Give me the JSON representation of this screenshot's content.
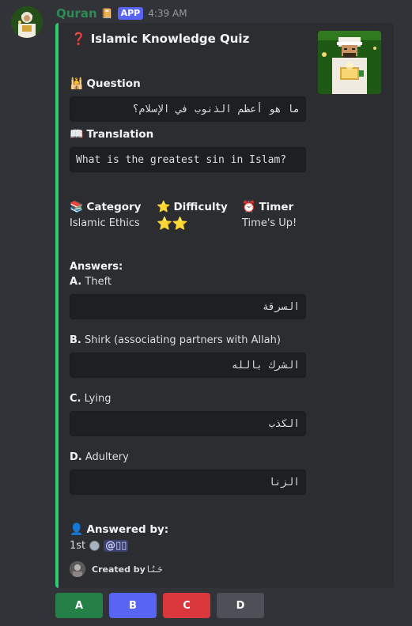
{
  "message": {
    "username": "Quran",
    "username_emoji": "📔",
    "app_badge": "APP",
    "timestamp": "4:39 AM"
  },
  "embed": {
    "accent_color": "#2ecc71",
    "title_icon": "❓",
    "title": "Islamic Knowledge Quiz",
    "question": {
      "icon": "🕌",
      "label": "Question",
      "text": "ما هو أعظم الذنوب في الإسلام؟"
    },
    "translation": {
      "icon": "📖",
      "label": "Translation",
      "text": "What is the greatest sin in Islam?"
    },
    "category": {
      "icon": "📚",
      "label": "Category",
      "value": "Islamic Ethics"
    },
    "difficulty": {
      "icon": "⭐",
      "label": "Difficulty",
      "value": "⭐⭐",
      "stars": 2
    },
    "timer": {
      "icon": "⏰",
      "label": "Timer",
      "value": "Time's Up!"
    },
    "answers_label": "Answers:",
    "answers": [
      {
        "letter": "A.",
        "text": "Theft",
        "arabic": "السرقة"
      },
      {
        "letter": "B.",
        "text": "Shirk (associating partners with Allah)",
        "arabic": "الشرك بالله"
      },
      {
        "letter": "C.",
        "text": "Lying",
        "arabic": "الكذب"
      },
      {
        "letter": "D.",
        "text": "Adultery",
        "arabic": "الزنا"
      }
    ],
    "answered_by": {
      "icon": "👤",
      "label": "Answered by:",
      "rank": "1st",
      "user": "@▯▯"
    },
    "footer": {
      "text": "Created by",
      "author": "خَـنُـا"
    }
  },
  "buttons": [
    {
      "label": "A",
      "color": "#248046"
    },
    {
      "label": "B",
      "color": "#5865f2"
    },
    {
      "label": "C",
      "color": "#da373c"
    },
    {
      "label": "D",
      "color": "#4e5058"
    }
  ]
}
